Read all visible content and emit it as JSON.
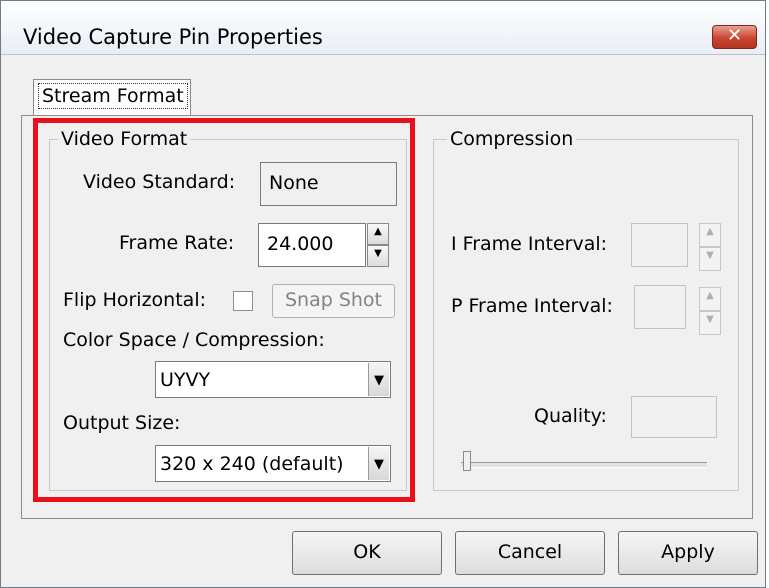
{
  "window": {
    "title": "Video Capture Pin Properties",
    "close_glyph": "✕"
  },
  "tabs": [
    {
      "label": "Stream Format"
    }
  ],
  "video_format": {
    "legend": "Video Format",
    "video_standard_label": "Video Standard:",
    "video_standard_value": "None",
    "frame_rate_label": "Frame Rate:",
    "frame_rate_value": "24.000",
    "flip_horizontal_label": "Flip Horizontal:",
    "snap_shot_label": "Snap Shot",
    "color_space_label": "Color Space / Compression:",
    "color_space_value": "UYVY",
    "output_size_label": "Output Size:",
    "output_size_value": "320 x 240  (default)"
  },
  "compression": {
    "legend": "Compression",
    "i_frame_label": "I Frame Interval:",
    "p_frame_label": "P Frame Interval:",
    "quality_label": "Quality:",
    "quality_slider_fraction": 0.0
  },
  "buttons": {
    "ok": "OK",
    "cancel": "Cancel",
    "apply": "Apply"
  },
  "icons": {
    "spin_up": "▲",
    "spin_down": "▼",
    "dropdown": "▼"
  },
  "colors": {
    "highlight_border": "#e8101a",
    "close_button": "#c8452f"
  }
}
